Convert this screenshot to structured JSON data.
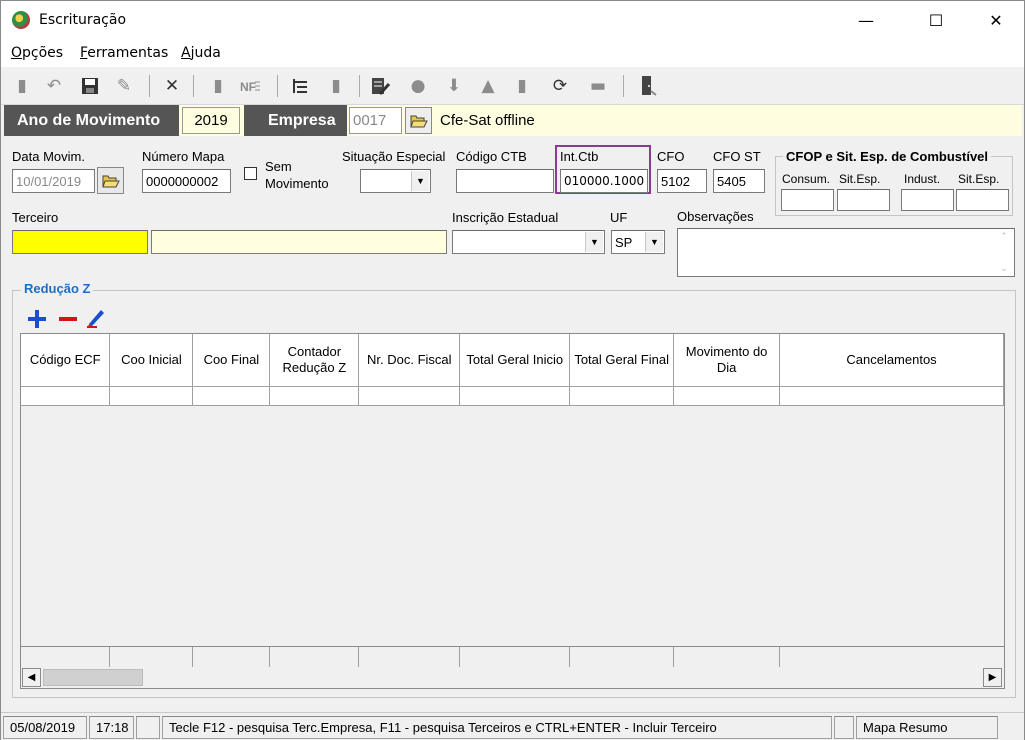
{
  "window": {
    "title": "Escrituração",
    "minimize": "—",
    "maximize": "☐",
    "close": "✕"
  },
  "menu": {
    "opcoes": {
      "first": "O",
      "rest": "pções"
    },
    "ferramentas": {
      "first": "F",
      "rest": "erramentas"
    },
    "ajuda": {
      "first": "A",
      "rest": "juda"
    }
  },
  "header": {
    "ano_label": "Ano de Movimento",
    "ano_value": "2019",
    "empresa_label": "Empresa",
    "empresa_code": "0017",
    "empresa_name": "Cfe-Sat  offline"
  },
  "form": {
    "data_movim_label": "Data Movim.",
    "data_movim_value": "10/01/2019",
    "numero_mapa_label": "Número Mapa",
    "numero_mapa_value": "0000000002",
    "sem_movimento_label_1": "Sem",
    "sem_movimento_label_2": "Movimento",
    "situacao_especial_label": "Situação Especial",
    "situacao_especial_value": "",
    "codigo_ctb_label": "Código CTB",
    "codigo_ctb_value": "",
    "int_ctb_label": "Int.Ctb",
    "int_ctb_value": "010000.1000",
    "cfo_label": "CFO",
    "cfo_value": "5102",
    "cfo_st_label": "CFO ST",
    "cfo_st_value": "5405",
    "cfop_group_title": "CFOP e Sit. Esp. de Combustível",
    "consum_label": "Consum.",
    "sit_esp_label_1": "Sit.Esp.",
    "indust_label": "Indust.",
    "sit_esp_label_2": "Sit.Esp.",
    "terceiro_label": "Terceiro",
    "inscricao_estadual_label": "Inscrição Estadual",
    "uf_label": "UF",
    "uf_value": "SP",
    "observacoes_label": "Observações"
  },
  "reducao_z": {
    "title": "Redução Z",
    "columns": [
      "Código ECF",
      "Coo Inicial",
      "Coo Final",
      "Contador Redução Z",
      "Nr. Doc. Fiscal",
      "Total Geral Inicio",
      "Total Geral Final",
      "Movimento do Dia",
      "Cancelamentos"
    ]
  },
  "status": {
    "date": "05/08/2019",
    "time": "17:18",
    "hint": "Tecle F12 - pesquisa Terc.Empresa, F11 - pesquisa Terceiros e CTRL+ENTER - Incluir Terceiro",
    "mode": "Mapa Resumo"
  },
  "colors": {
    "highlight_border": "#8b3a96",
    "header_dark": "#555555",
    "terceiro_yellow": "#ffff00",
    "add_icon": "#1a4fc9",
    "remove_icon": "#d11414"
  }
}
